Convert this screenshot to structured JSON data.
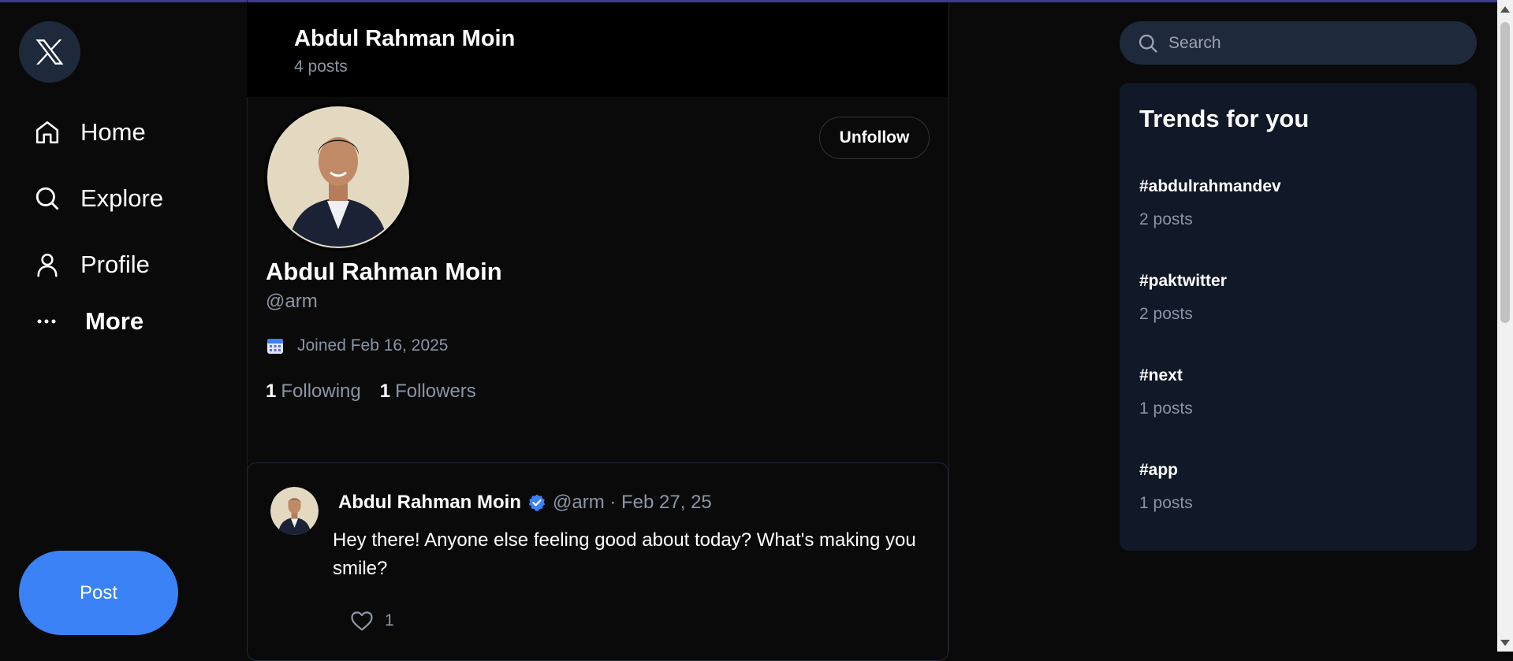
{
  "app": {
    "logo": "x-logo-icon",
    "accent_color": "#3b82f6"
  },
  "sidebar": {
    "items": [
      {
        "label": "Home",
        "icon": "home-icon"
      },
      {
        "label": "Explore",
        "icon": "search-icon"
      },
      {
        "label": "Profile",
        "icon": "user-icon"
      },
      {
        "label": "More",
        "icon": "more-dots-icon"
      }
    ],
    "post_button": "Post"
  },
  "header": {
    "name": "Abdul Rahman Moin",
    "post_count": "4 posts"
  },
  "profile": {
    "name": "Abdul Rahman Moin",
    "handle": "@arm",
    "joined": "Joined Feb 16, 2025",
    "following_count": "1",
    "following_label": "Following",
    "followers_count": "1",
    "followers_label": "Followers",
    "unfollow_label": "Unfollow"
  },
  "posts": [
    {
      "author": "Abdul Rahman Moin",
      "handle": "@arm",
      "date": "Feb 27, 25",
      "verified": true,
      "text": "Hey there! Anyone else feeling good about today? What's making you smile?",
      "likes": "1"
    }
  ],
  "search": {
    "placeholder": "Search"
  },
  "trends": {
    "title": "Trends for you",
    "items": [
      {
        "tag": "#abdulrahmandev",
        "count": "2 posts"
      },
      {
        "tag": "#paktwitter",
        "count": "2 posts"
      },
      {
        "tag": "#next",
        "count": "1 posts"
      },
      {
        "tag": "#app",
        "count": "1 posts"
      }
    ]
  }
}
